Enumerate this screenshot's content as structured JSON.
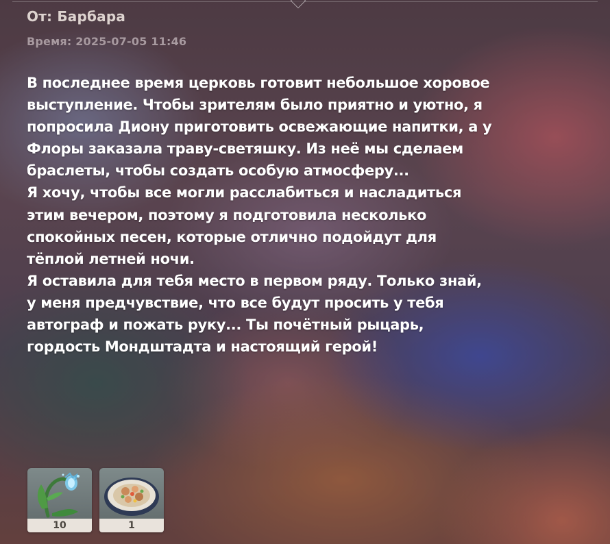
{
  "mail": {
    "sender": "От: Барбара",
    "time": "Время: 2025-07-05 11:46",
    "paragraphs": [
      "В последнее время церковь готовит небольшое хоровое\nвыступление. Чтобы зрителям было приятно и уютно, я\nпопросила Диону приготовить освежающие напитки, а у\nФлоры заказала траву-светяшку. Из неё мы сделаем\nбраслеты, чтобы создать особую атмосферу...",
      "Я хочу, чтобы все могли расслабиться и насладиться\nэтим вечером, поэтому я подготовила несколько\nспокойных песен, которые отлично подойдут для\nтёплой летней ночи.",
      "Я оставила для тебя место в первом ряду. Только знай,\nу меня предчувствие, что все будут просить у тебя\nавтограф и пожать руку... Ты почётный рыцарь,\nгордость Мондштадта и настоящий герой!"
    ]
  },
  "attachments": [
    {
      "icon": "glowing-flower-icon",
      "count": "10"
    },
    {
      "icon": "food-dish-icon",
      "count": "1"
    }
  ]
}
